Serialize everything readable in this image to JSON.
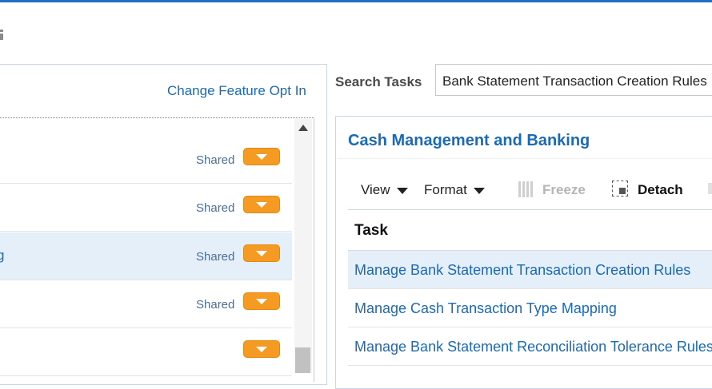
{
  "left": {
    "change_link": "Change Feature Opt In",
    "rows": [
      {
        "label": "",
        "shared": "Shared"
      },
      {
        "label": "",
        "shared": "Shared"
      },
      {
        "label": "g",
        "shared": "Shared"
      },
      {
        "label": "",
        "shared": "Shared"
      },
      {
        "label": "",
        "shared": ""
      }
    ]
  },
  "search": {
    "label": "Search Tasks",
    "value": "Bank Statement Transaction Creation Rules"
  },
  "right": {
    "title": "Cash Management and Banking",
    "toolbar": {
      "view": "View",
      "format": "Format",
      "freeze": "Freeze",
      "detach": "Detach"
    },
    "table": {
      "header": "Task",
      "rows": [
        "Manage Bank Statement Transaction Creation Rules",
        "Manage Cash Transaction Type Mapping",
        "Manage Bank Statement Reconciliation Tolerance Rules"
      ]
    }
  },
  "colors": {
    "accent": "#1a6ab5",
    "top_bar": "#1f6fc5",
    "dropdown_button": "#f59a23",
    "selected_row": "#e4effa"
  },
  "icons": {
    "toolbar_left": "page-icon",
    "dropdown": "chevron-down-icon",
    "freeze": "freeze-columns-icon",
    "detach": "detach-icon"
  }
}
